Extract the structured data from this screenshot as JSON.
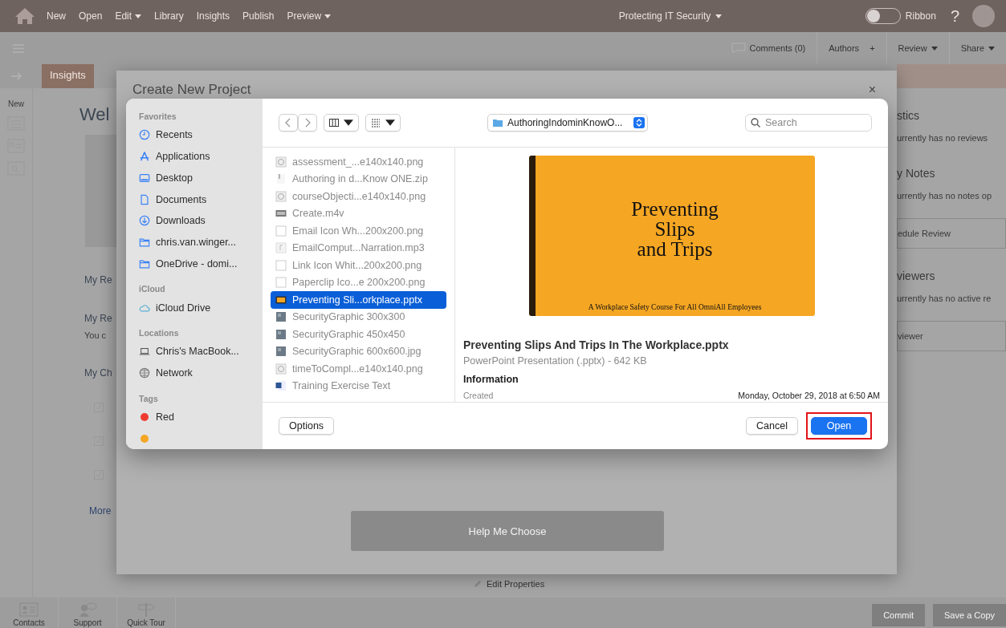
{
  "app_bar": {
    "menu": [
      {
        "label": "New",
        "dropdown": false
      },
      {
        "label": "Open",
        "dropdown": false
      },
      {
        "label": "Edit",
        "dropdown": true
      },
      {
        "label": "Library",
        "dropdown": false
      },
      {
        "label": "Insights",
        "dropdown": false
      },
      {
        "label": "Publish",
        "dropdown": false
      },
      {
        "label": "Preview",
        "dropdown": true
      }
    ],
    "title": "Protecting IT Security",
    "ribbon": {
      "label": "Ribbon",
      "on": false
    },
    "help": "?"
  },
  "toolbar": {
    "comments": "Comments (0)",
    "authors": "Authors",
    "add": "+",
    "review": "Review",
    "share": "Share"
  },
  "tab_row": {
    "tab": "Insights"
  },
  "left_nav": {
    "label": "New"
  },
  "left_panel": {
    "welcome": "Wel",
    "sections": [
      {
        "title": "My Re"
      },
      {
        "title": "My Re",
        "text": "You c"
      },
      {
        "title": "My Ch"
      }
    ],
    "more": "More"
  },
  "right_panel": [
    {
      "title": "stics",
      "text": "urrently has no reviews"
    },
    {
      "title": "y Notes",
      "text": "urrently has no notes op",
      "button": "edule Review"
    },
    {
      "title": "viewers",
      "text": "urrently has no active re",
      "button": "viewer"
    }
  ],
  "bottom_bar": {
    "tools": [
      {
        "kind": "contacts",
        "label": "Contacts"
      },
      {
        "kind": "support",
        "label": "Support"
      },
      {
        "kind": "tour",
        "label": "Quick Tour"
      }
    ],
    "edit_properties": "Edit Properties",
    "commit": "Commit",
    "save_copy": "Save a Copy"
  },
  "modal": {
    "title": "Create New Project",
    "close": "×",
    "help_button": "Help Me Choose"
  },
  "file_dialog": {
    "sidebar": [
      {
        "heading": "Favorites",
        "items": [
          {
            "kind": "clock",
            "label": "Recents"
          },
          {
            "kind": "apps",
            "label": "Applications"
          },
          {
            "kind": "desktop",
            "label": "Desktop"
          },
          {
            "kind": "doc",
            "label": "Documents"
          },
          {
            "kind": "download",
            "label": "Downloads"
          },
          {
            "kind": "folder",
            "label": "chris.van.winger..."
          },
          {
            "kind": "folder",
            "label": "OneDrive - domi..."
          }
        ]
      },
      {
        "heading": "iCloud",
        "items": [
          {
            "kind": "cloud",
            "label": "iCloud Drive"
          }
        ]
      },
      {
        "heading": "Locations",
        "items": [
          {
            "kind": "laptop",
            "label": "Chris's MacBook..."
          },
          {
            "kind": "globe",
            "label": "Network"
          }
        ]
      },
      {
        "heading": "Tags",
        "items": [
          {
            "kind": "tag",
            "label": "Red",
            "color": "#ee3b30"
          },
          {
            "kind": "tag",
            "color": "#f5a623"
          }
        ]
      }
    ],
    "location": "AuthoringIndominKnowO...",
    "search": {
      "placeholder": "Search"
    },
    "files": [
      {
        "kind": "image",
        "name": "assessment_...e140x140.png",
        "selected": false,
        "disabled": true
      },
      {
        "kind": "zip",
        "name": "Authoring in d...Know ONE.zip",
        "selected": false,
        "disabled": true
      },
      {
        "kind": "image",
        "name": "courseObjecti...e140x140.png",
        "selected": false,
        "disabled": true
      },
      {
        "kind": "video",
        "name": "Create.m4v",
        "selected": false,
        "disabled": true
      },
      {
        "kind": "blank",
        "name": "Email Icon Wh...200x200.png",
        "selected": false,
        "disabled": true
      },
      {
        "kind": "audio",
        "name": "EmailComput...Narration.mp3",
        "selected": false,
        "disabled": true
      },
      {
        "kind": "blank",
        "name": "Link Icon Whit...200x200.png",
        "selected": false,
        "disabled": true
      },
      {
        "kind": "blank",
        "name": "Paperclip Ico...e 200x200.png",
        "selected": false,
        "disabled": true
      },
      {
        "kind": "slides",
        "name": "Preventing Sli...orkplace.pptx",
        "selected": true,
        "disabled": false
      },
      {
        "kind": "graphic",
        "name": "SecurityGraphic 300x300",
        "selected": false,
        "disabled": true
      },
      {
        "kind": "graphic",
        "name": "SecurityGraphic 450x450",
        "selected": false,
        "disabled": true
      },
      {
        "kind": "graphic",
        "name": "SecurityGraphic 600x600.jpg",
        "selected": false,
        "disabled": true
      },
      {
        "kind": "image",
        "name": "timeToCompl...e140x140.png",
        "selected": false,
        "disabled": true
      },
      {
        "kind": "word",
        "name": "Training Exercise Text",
        "selected": false,
        "disabled": true
      }
    ],
    "preview": {
      "slide_title": "Preventing\nSlips\nand Trips",
      "slide_subtitle": "A Workplace Safety Course For All OmniAll Employees",
      "file_name": "Preventing Slips And Trips In The Workplace.pptx",
      "file_type": "PowerPoint Presentation (.pptx) - 642 KB",
      "info_heading": "Information",
      "info": [
        {
          "label": "Created",
          "value": "Monday, October 29, 2018 at 6:50 AM"
        }
      ]
    },
    "options": "Options",
    "cancel": "Cancel",
    "open": "Open",
    "open_highlighted": true
  }
}
